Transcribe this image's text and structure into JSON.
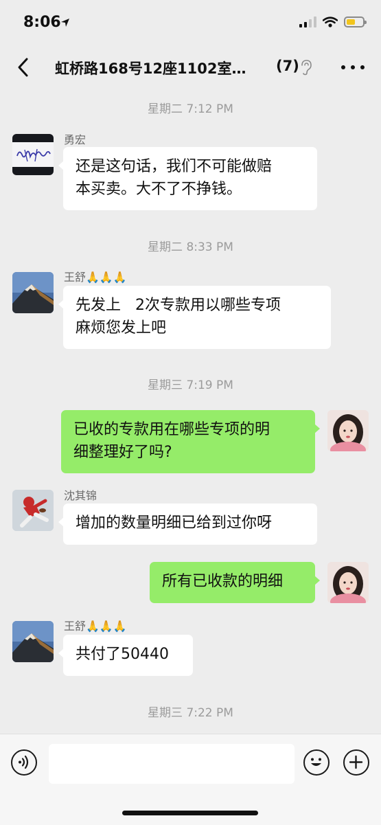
{
  "status_bar": {
    "time": "8:06"
  },
  "nav": {
    "title": "虹桥路168号12座1102室…",
    "member_count": "(7)"
  },
  "timestamps": [
    "星期二 7:12 PM",
    "星期二 8:33 PM",
    "星期三 7:19 PM",
    "星期三 7:22 PM"
  ],
  "messages": [
    {
      "sender": "勇宏",
      "lines": [
        "还是这句话，我们不可能做赔",
        "本买卖。大不了不挣钱。"
      ]
    },
    {
      "sender": "王舒🙏🙏🙏",
      "lines": [
        "先发上   2次专款用以哪些专项",
        "麻烦您发上吧"
      ]
    },
    {
      "sender": "",
      "lines": [
        "已收的专款用在哪些专项的明",
        "细整理好了吗?"
      ]
    },
    {
      "sender": "沈其锦",
      "lines": [
        "增加的数量明细已给到过你呀"
      ]
    },
    {
      "sender": "",
      "lines": [
        "所有已收款的明细"
      ]
    },
    {
      "sender": "王舒🙏🙏🙏",
      "lines": [
        "共付了50440"
      ]
    }
  ],
  "input": {
    "placeholder": ""
  },
  "colors": {
    "outgoing_bubble": "#95ec69",
    "incoming_bubble": "#ffffff",
    "background": "#ededed"
  }
}
